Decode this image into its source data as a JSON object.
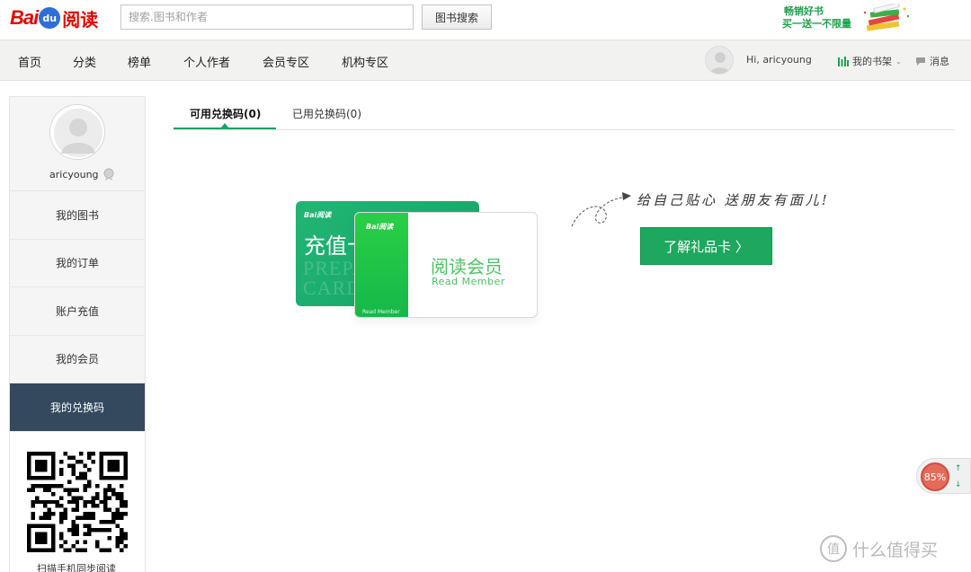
{
  "header": {
    "logo_text_bai": "Bai",
    "logo_text_du": "du",
    "logo_text_yuedu": "阅读",
    "search": {
      "placeholder": "搜索.图书和作者",
      "button_label": "图书搜索"
    },
    "promo": {
      "line1": "畅销好书",
      "line2": "买一送一不限量"
    }
  },
  "nav": {
    "items": [
      "首页",
      "分类",
      "榜单",
      "个人作者",
      "会员专区",
      "机构专区"
    ],
    "greeting": "Hi, aricyoung",
    "shelf_label": "我的书架",
    "message_label": "消息"
  },
  "sidebar": {
    "username": "aricyoung",
    "items": [
      "我的图书",
      "我的订单",
      "账户充值",
      "我的会员",
      "我的兑换码"
    ],
    "active_index": 4,
    "qr_caption": "扫描手机同步阅读"
  },
  "tabs": [
    {
      "label": "可用兑换码(0)",
      "active": true
    },
    {
      "label": "已用兑换码(0)",
      "active": false
    }
  ],
  "promo_area": {
    "prepaid_card": {
      "logo": "Bai阅读",
      "title": "充值卡",
      "watermark_line1": "PREPAID",
      "watermark_line2": "CARD"
    },
    "member_card": {
      "logo": "Bai阅读",
      "strip_label": "Read Member",
      "title_cn": "阅读会员",
      "title_en": "Read Member"
    },
    "tagline": "给自己贴心 送朋友有面儿!",
    "gift_button_label": "了解礼品卡 〉"
  },
  "float_widget": {
    "percent": "85%"
  },
  "watermark": {
    "text": "什么值得买",
    "icon": "值"
  },
  "colors": {
    "accent": "#1ea75e",
    "active_sidebar": "#34495e",
    "brand_red": "#e10601"
  }
}
